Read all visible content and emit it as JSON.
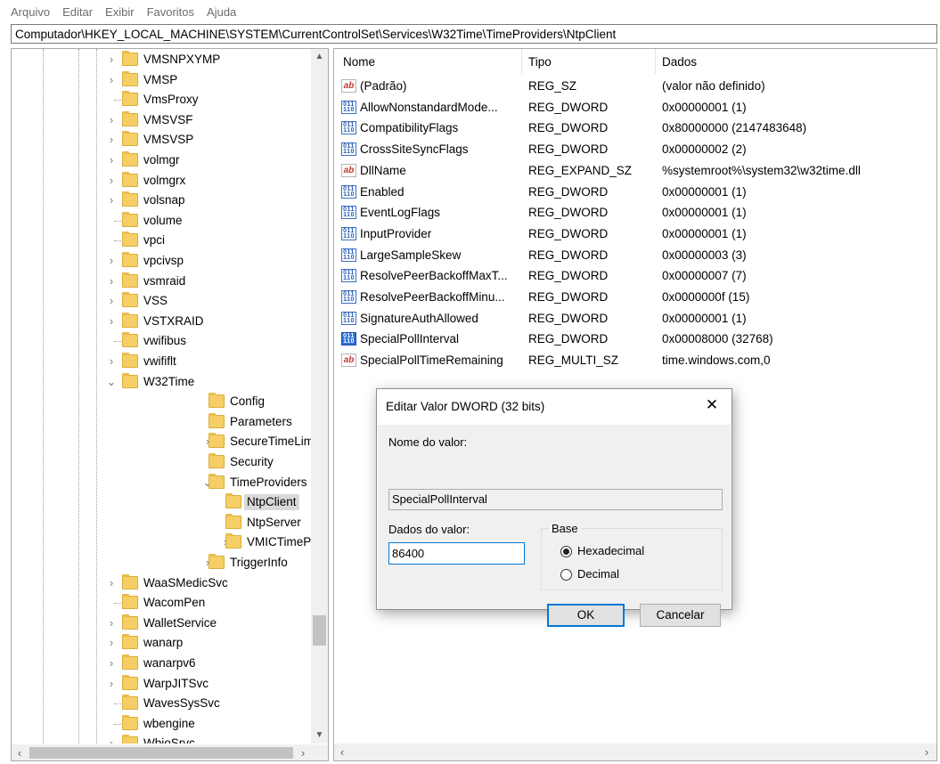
{
  "menu": [
    "Arquivo",
    "Editar",
    "Exibir",
    "Favoritos",
    "Ajuda"
  ],
  "address": "Computador\\HKEY_LOCAL_MACHINE\\SYSTEM\\CurrentControlSet\\Services\\W32Time\\TimeProviders\\NtpClient",
  "tree": [
    {
      "label": "VMSNPXYMP",
      "level": 0,
      "expander": "collapsed"
    },
    {
      "label": "VMSP",
      "level": 0,
      "expander": "collapsed"
    },
    {
      "label": "VmsProxy",
      "level": 0,
      "expander": "none"
    },
    {
      "label": "VMSVSF",
      "level": 0,
      "expander": "collapsed"
    },
    {
      "label": "VMSVSP",
      "level": 0,
      "expander": "collapsed"
    },
    {
      "label": "volmgr",
      "level": 0,
      "expander": "collapsed"
    },
    {
      "label": "volmgrx",
      "level": 0,
      "expander": "collapsed"
    },
    {
      "label": "volsnap",
      "level": 0,
      "expander": "collapsed"
    },
    {
      "label": "volume",
      "level": 0,
      "expander": "none"
    },
    {
      "label": "vpci",
      "level": 0,
      "expander": "none"
    },
    {
      "label": "vpcivsp",
      "level": 0,
      "expander": "collapsed"
    },
    {
      "label": "vsmraid",
      "level": 0,
      "expander": "collapsed"
    },
    {
      "label": "VSS",
      "level": 0,
      "expander": "collapsed"
    },
    {
      "label": "VSTXRAID",
      "level": 0,
      "expander": "collapsed"
    },
    {
      "label": "vwifibus",
      "level": 0,
      "expander": "none"
    },
    {
      "label": "vwififlt",
      "level": 0,
      "expander": "collapsed"
    },
    {
      "label": "W32Time",
      "level": 0,
      "expander": "expanded"
    },
    {
      "label": "Config",
      "level": 1,
      "expander": "none"
    },
    {
      "label": "Parameters",
      "level": 1,
      "expander": "none"
    },
    {
      "label": "SecureTimeLimits",
      "level": 1,
      "expander": "collapsed"
    },
    {
      "label": "Security",
      "level": 1,
      "expander": "none"
    },
    {
      "label": "TimeProviders",
      "level": 1,
      "expander": "expanded"
    },
    {
      "label": "NtpClient",
      "level": 2,
      "expander": "none",
      "selected": true
    },
    {
      "label": "NtpServer",
      "level": 2,
      "expander": "none"
    },
    {
      "label": "VMICTimeProvider",
      "level": 2,
      "expander": "collapsed"
    },
    {
      "label": "TriggerInfo",
      "level": 1,
      "expander": "collapsed"
    },
    {
      "label": "WaaSMedicSvc",
      "level": 0,
      "expander": "collapsed"
    },
    {
      "label": "WacomPen",
      "level": 0,
      "expander": "none"
    },
    {
      "label": "WalletService",
      "level": 0,
      "expander": "collapsed"
    },
    {
      "label": "wanarp",
      "level": 0,
      "expander": "collapsed"
    },
    {
      "label": "wanarpv6",
      "level": 0,
      "expander": "collapsed"
    },
    {
      "label": "WarpJITSvc",
      "level": 0,
      "expander": "collapsed"
    },
    {
      "label": "WavesSysSvc",
      "level": 0,
      "expander": "none"
    },
    {
      "label": "wbengine",
      "level": 0,
      "expander": "none"
    },
    {
      "label": "WbioSrvc",
      "level": 0,
      "expander": "collapsed"
    }
  ],
  "list": {
    "columns": [
      "Nome",
      "Tipo",
      "Dados"
    ],
    "rows": [
      {
        "icon": "string-icon",
        "name": "(Padrão)",
        "type": "REG_SZ",
        "data": "(valor não definido)"
      },
      {
        "icon": "binary-icon",
        "name": "AllowNonstandardMode...",
        "type": "REG_DWORD",
        "data": "0x00000001 (1)"
      },
      {
        "icon": "binary-icon",
        "name": "CompatibilityFlags",
        "type": "REG_DWORD",
        "data": "0x80000000 (2147483648)"
      },
      {
        "icon": "binary-icon",
        "name": "CrossSiteSyncFlags",
        "type": "REG_DWORD",
        "data": "0x00000002 (2)"
      },
      {
        "icon": "string-icon",
        "name": "DllName",
        "type": "REG_EXPAND_SZ",
        "data": "%systemroot%\\system32\\w32time.dll"
      },
      {
        "icon": "binary-icon",
        "name": "Enabled",
        "type": "REG_DWORD",
        "data": "0x00000001 (1)"
      },
      {
        "icon": "binary-icon",
        "name": "EventLogFlags",
        "type": "REG_DWORD",
        "data": "0x00000001 (1)"
      },
      {
        "icon": "binary-icon",
        "name": "InputProvider",
        "type": "REG_DWORD",
        "data": "0x00000001 (1)"
      },
      {
        "icon": "binary-icon",
        "name": "LargeSampleSkew",
        "type": "REG_DWORD",
        "data": "0x00000003 (3)"
      },
      {
        "icon": "binary-icon",
        "name": "ResolvePeerBackoffMaxT...",
        "type": "REG_DWORD",
        "data": "0x00000007 (7)"
      },
      {
        "icon": "binary-icon",
        "name": "ResolvePeerBackoffMinu...",
        "type": "REG_DWORD",
        "data": "0x0000000f (15)"
      },
      {
        "icon": "binary-icon",
        "name": "SignatureAuthAllowed",
        "type": "REG_DWORD",
        "data": "0x00000001 (1)"
      },
      {
        "icon": "binary-icon",
        "name": "SpecialPollInterval",
        "type": "REG_DWORD",
        "data": "0x00008000 (32768)",
        "selected": true
      },
      {
        "icon": "string-icon",
        "name": "SpecialPollTimeRemaining",
        "type": "REG_MULTI_SZ",
        "data": "time.windows.com,0"
      }
    ]
  },
  "dialog": {
    "title": "Editar Valor DWORD (32 bits)",
    "close": "✕",
    "name_label": "Nome do valor:",
    "name_value": "SpecialPollInterval",
    "data_label": "Dados do valor:",
    "data_value": "86400",
    "base_label": "Base",
    "hex_label": "Hexadecimal",
    "dec_label": "Decimal",
    "base_selected": "Hexadecimal",
    "ok_label": "OK",
    "cancel_label": "Cancelar"
  },
  "icons": {
    "expander_collapsed": "chevron-right-icon",
    "expander_expanded": "chevron-down-icon",
    "folder": "folder-icon"
  },
  "colors": {
    "folder": "#f5cf66",
    "selection": "#d9d9d9",
    "focus": "#0078d7"
  }
}
